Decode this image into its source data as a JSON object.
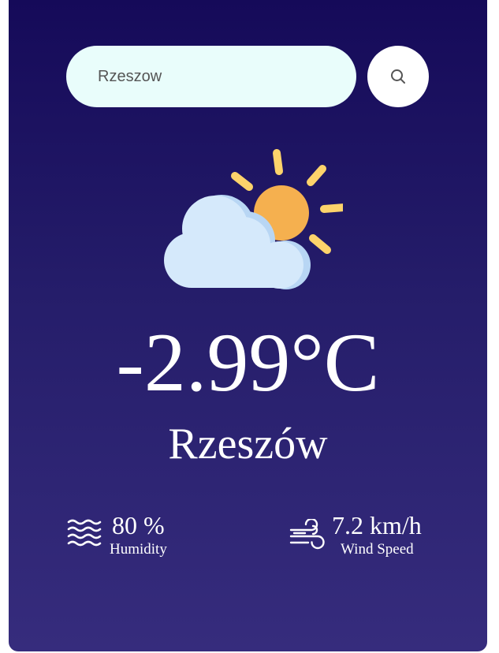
{
  "search": {
    "value": "Rzeszow",
    "icon": "search-icon"
  },
  "weather": {
    "icon": "partly-cloudy-icon",
    "temperature": "-2.99°C",
    "city": "Rzeszów"
  },
  "details": {
    "humidity": {
      "icon": "humidity-waves-icon",
      "value": "80 %",
      "label": "Humidity"
    },
    "wind": {
      "icon": "wind-icon",
      "value": "7.2 km/h",
      "label": "Wind Speed"
    }
  },
  "colors": {
    "background_top": "#150a59",
    "background_bottom": "#362c7d",
    "search_field": "#e9fdfb",
    "sun": "#f5b04f",
    "sun_rays": "#fdd36b",
    "cloud": "#d5e9fb"
  }
}
